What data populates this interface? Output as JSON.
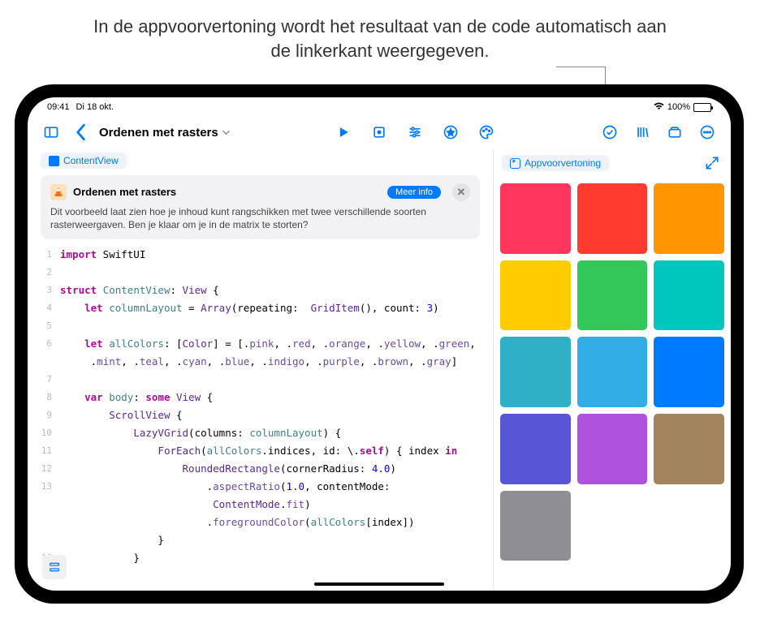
{
  "caption": "In de appvoorvertoning wordt het resultaat van de code automatisch aan de linkerkant weergegeven.",
  "status": {
    "time": "09:41",
    "date": "Di 18 okt.",
    "battery_pct": "100%"
  },
  "toolbar": {
    "doc_title": "Ordenen met rasters"
  },
  "editor": {
    "tab_label": "ContentView",
    "info_title": "Ordenen met rasters",
    "info_more": "Meer info",
    "info_desc": "Dit voorbeeld laat zien hoe je inhoud kunt rangschikken met twee verschillende soorten rasterweergaven. Ben je klaar om je in de matrix te storten?"
  },
  "code": {
    "lines": [
      {
        "n": 1,
        "html": "<span class='kw'>import</span><span class='txt'> SwiftUI</span>"
      },
      {
        "n": 2,
        "html": ""
      },
      {
        "n": 3,
        "html": "<span class='kw'>struct</span><span class='txt'> </span><span class='typD'>ContentView</span><span class='txt'>: </span><span class='typ'>View</span><span class='txt'> {</span>"
      },
      {
        "n": 4,
        "html": "    <span class='kw'>let</span><span class='txt'> </span><span class='vr'>columnLayout</span><span class='txt'> = </span><span class='typ'>Array</span><span class='txt'>(repeating:  </span><span class='typ'>GridItem</span><span class='txt'>(), count: </span><span class='num'>3</span><span class='txt'>)</span>"
      },
      {
        "n": 5,
        "html": ""
      },
      {
        "n": 6,
        "html": "    <span class='kw'>let</span><span class='txt'> </span><span class='vr'>allColors</span><span class='txt'>: [</span><span class='typ'>Color</span><span class='txt'>] = [.</span><span class='enm'>pink</span><span class='txt'>, .</span><span class='enm'>red</span><span class='txt'>, .</span><span class='enm'>orange</span><span class='txt'>, .</span><span class='enm'>yellow</span><span class='txt'>, .</span><span class='enm'>green</span><span class='txt'>,</span>"
      },
      {
        "n": "",
        "html": "     <span class='txt'>.</span><span class='enm'>mint</span><span class='txt'>, .</span><span class='enm'>teal</span><span class='txt'>, .</span><span class='enm'>cyan</span><span class='txt'>, .</span><span class='enm'>blue</span><span class='txt'>, .</span><span class='enm'>indigo</span><span class='txt'>, .</span><span class='enm'>purple</span><span class='txt'>, .</span><span class='enm'>brown</span><span class='txt'>, .</span><span class='enm'>gray</span><span class='txt'>]</span>"
      },
      {
        "n": 7,
        "html": ""
      },
      {
        "n": 8,
        "html": "    <span class='kw'>var</span><span class='txt'> </span><span class='vr'>body</span><span class='txt'>: </span><span class='kw'>some</span><span class='txt'> </span><span class='typ'>View</span><span class='txt'> {</span>"
      },
      {
        "n": 9,
        "html": "        <span class='typ'>ScrollView</span><span class='txt'> {</span>"
      },
      {
        "n": 10,
        "html": "            <span class='typ'>LazyVGrid</span><span class='txt'>(columns: </span><span class='vr'>columnLayout</span><span class='txt'>) {</span>"
      },
      {
        "n": 11,
        "html": "                <span class='typ'>ForEach</span><span class='txt'>(</span><span class='vr'>allColors</span><span class='txt'>.indices, id: \\.</span><span class='kw'>self</span><span class='txt'>) { index </span><span class='kw'>in</span>"
      },
      {
        "n": 12,
        "html": "                    <span class='typ'>RoundedRectangle</span><span class='txt'>(cornerRadius: </span><span class='num'>4.0</span><span class='txt'>)</span>"
      },
      {
        "n": 13,
        "html": "                        <span class='txt'>.</span><span class='fn'>aspectRatio</span><span class='txt'>(</span><span class='num'>1.0</span><span class='txt'>, contentMode:</span>"
      },
      {
        "n": "",
        "html": "                         <span class='typ'>ContentMode</span><span class='txt'>.</span><span class='enm'>fit</span><span class='txt'>)</span>"
      },
      {
        "n": "",
        "html": "                        <span class='txt'>.</span><span class='fn'>foregroundColor</span><span class='txt'>(</span><span class='vr'>allColors</span><span class='txt'>[index])</span>"
      },
      {
        "n": "",
        "html": "                <span class='txt'>}</span>"
      },
      {
        "n": 16,
        "html": "            <span class='txt'>}</span>"
      }
    ]
  },
  "preview": {
    "tab_label": "Appvoorvertoning",
    "colors": [
      "#ff375f",
      "#ff3b30",
      "#ff9500",
      "#ffcc00",
      "#34c759",
      "#00c7be",
      "#30b0c7",
      "#32ade6",
      "#007aff",
      "#5856d6",
      "#af52de",
      "#a2845e",
      "#8e8e93"
    ]
  }
}
